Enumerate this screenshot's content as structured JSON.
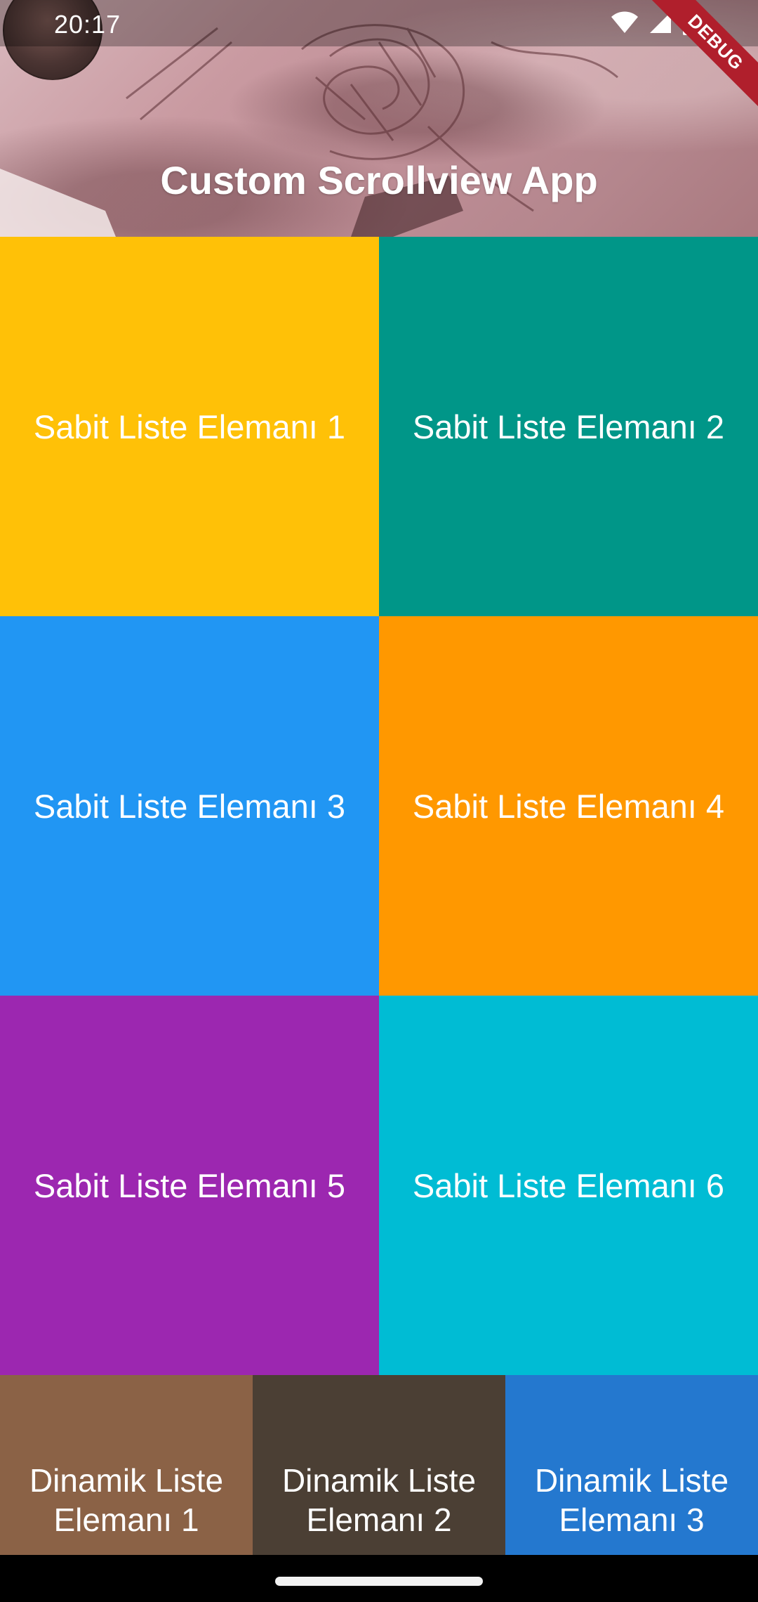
{
  "status_bar": {
    "time": "20:17",
    "icons": [
      "wifi-icon",
      "signal-icon",
      "battery-icon"
    ]
  },
  "debug_banner": "DEBUG",
  "app_bar": {
    "title": "Custom Scrollview App"
  },
  "fixed_grid": {
    "items": [
      {
        "label": "Sabit Liste Elemanı 1",
        "color": "#FFC107"
      },
      {
        "label": "Sabit Liste Elemanı 2",
        "color": "#009688"
      },
      {
        "label": "Sabit Liste Elemanı 3",
        "color": "#2196F3"
      },
      {
        "label": "Sabit Liste Elemanı 4",
        "color": "#FF9800"
      },
      {
        "label": "Sabit Liste Elemanı 5",
        "color": "#9C27B0"
      },
      {
        "label": "Sabit Liste Elemanı 6",
        "color": "#00BCD4"
      }
    ]
  },
  "dynamic_row": {
    "items": [
      {
        "line1": "Dinamik Liste",
        "line2": "Elemanı 1",
        "color": "#8B6246"
      },
      {
        "line1": "Dinamik Liste",
        "line2": "Elemanı 2",
        "color": "#4B3F34"
      },
      {
        "line1": "Dinamik Liste",
        "line2": "Elemanı 3",
        "color": "#2478CF"
      }
    ]
  }
}
